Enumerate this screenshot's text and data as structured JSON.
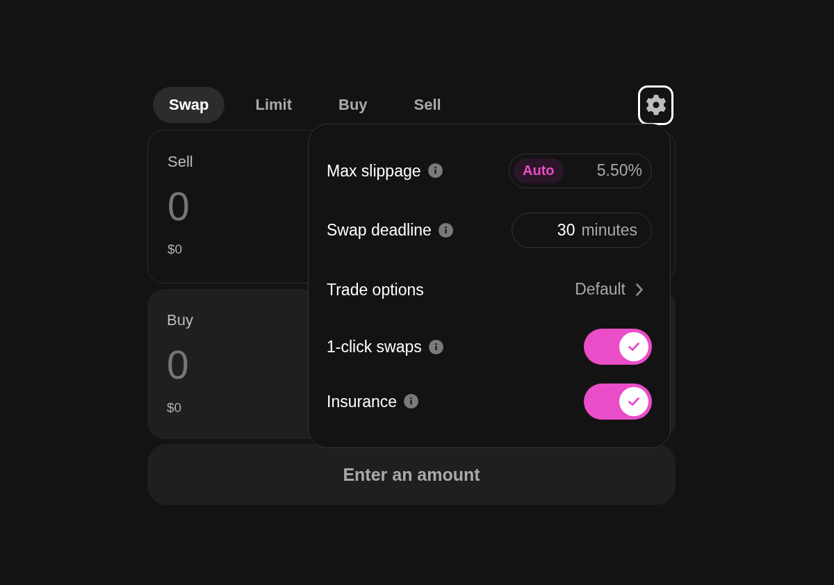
{
  "tabs": [
    {
      "label": "Swap",
      "selected": true
    },
    {
      "label": "Limit",
      "selected": false
    },
    {
      "label": "Buy",
      "selected": false
    },
    {
      "label": "Sell",
      "selected": false
    }
  ],
  "settings_button": {
    "active": true
  },
  "sell_panel": {
    "label": "Sell",
    "placeholder": "0",
    "fiat_value": "$0"
  },
  "buy_panel": {
    "label": "Buy",
    "placeholder": "0",
    "fiat_value": "$0"
  },
  "submit_button": {
    "label": "Enter an amount",
    "disabled": true
  },
  "settings_popover": {
    "rows": [
      {
        "kind": "slippage",
        "label": "Max slippage",
        "info": true,
        "mode": {
          "label": "Auto",
          "selected": true
        },
        "placeholder": "5.50%"
      },
      {
        "kind": "deadline",
        "label": "Swap deadline",
        "info": true,
        "value": "30",
        "unit": "minutes"
      },
      {
        "kind": "link",
        "label": "Trade options",
        "info": false,
        "value": "Default"
      },
      {
        "kind": "toggle",
        "label": "1-click swaps",
        "info": true,
        "on": true
      },
      {
        "kind": "toggle",
        "label": "Insurance",
        "info": true,
        "on": true
      }
    ]
  }
}
